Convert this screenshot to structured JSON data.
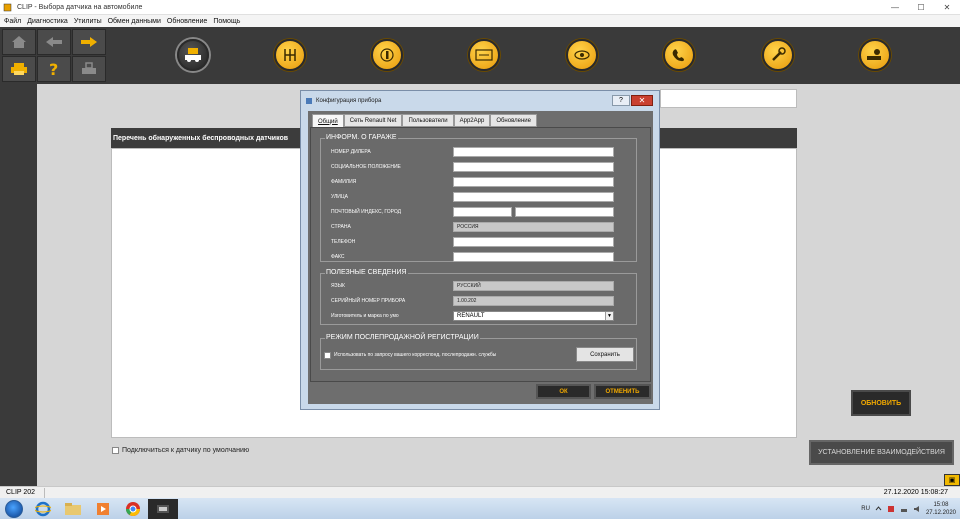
{
  "window": {
    "title": "CLIP - Выбора датчика на автомобиле",
    "minimize": "—",
    "maximize": "☐",
    "close": "✕"
  },
  "menu": [
    "Файл",
    "Диагностика",
    "Утилиты",
    "Обмен данными",
    "Обновление",
    "Помощь"
  ],
  "nav_icons": [
    "home-icon",
    "back-arrow-icon",
    "forward-arrow-icon",
    "printer-icon",
    "help-icon",
    "vehicle-lock-icon"
  ],
  "tool_icons": [
    "car-sensor-icon",
    "gearbox-icon",
    "touch-icon",
    "ecu-icon",
    "car-diagnostic-icon",
    "phone-icon",
    "wrench-icon",
    "car-service-icon"
  ],
  "main": {
    "list_header": "Перечень обнаруженных беспроводных датчиков",
    "default_checkbox_label": "Подключиться к датчику по умолчанию",
    "update_button": "ОБНОВИТЬ",
    "connect_button": "УСТАНОВЛЕНИЕ ВЗАИМОДЕЙСТВИЯ"
  },
  "dialog": {
    "title": "Конфигурация прибора",
    "help": "?",
    "close": "✕",
    "tabs": [
      "Общий",
      "Сеть Renault Net",
      "Пользователи",
      "App2App",
      "Обновление"
    ],
    "garage": {
      "title": "ИНФОРМ. О ГАРАЖЕ",
      "dealer_number": "НОМЕР ДИЛЕРА",
      "social_status": "СОЦИАЛЬНОЕ ПОЛОЖЕНИЕ",
      "last_name": "ФАМИЛИЯ",
      "street": "УЛИЦА",
      "postal_city": "ПОЧТОВЫЙ ИНДЕКС, ГОРОД",
      "country": "СТРАНА",
      "country_value": "РОССИЯ",
      "phone": "ТЕЛЕФОН",
      "fax": "ФАКС"
    },
    "info": {
      "title": "ПОЛЕЗНЫЕ СВЕДЕНИЯ",
      "language": "ЯЗЫК",
      "language_value": "РУССКИЙ",
      "serial": "СЕРИЙНЫЙ НОМЕР ПРИБОРА",
      "serial_value": "1.00.202",
      "brand": "Изготовитель и марка по умо",
      "brand_value": "RENAULT",
      "dropdown_arrow": "▼"
    },
    "after_sales": {
      "title": "РЕЖИМ ПОСЛЕПРОДАЖНОЙ РЕГИСТРАЦИИ",
      "checkbox_label": "Использовать по запросу вашего корреспонд. послепродажн. службы",
      "save_button": "Сохранить"
    },
    "ok_button": "ОК",
    "cancel_button": "ОТМЕНИТЬ"
  },
  "status": {
    "left": "CLIP 202",
    "right": "27.12.2020 15:08:27"
  },
  "taskbar": {
    "apps": [
      "ie-icon",
      "explorer-icon",
      "media-player-icon",
      "chrome-icon",
      "clip-app-icon"
    ],
    "lang": "RU",
    "time": "15:08",
    "date": "27.12.2020"
  }
}
